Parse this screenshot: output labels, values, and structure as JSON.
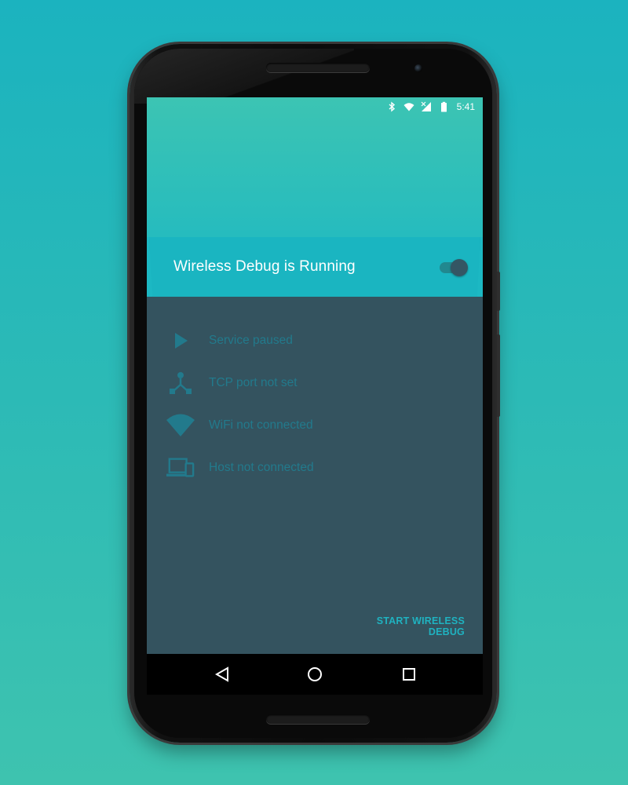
{
  "statusbar": {
    "time": "5:41",
    "icons": [
      "bluetooth-icon",
      "wifi-icon",
      "cell-signal-icon",
      "battery-icon"
    ]
  },
  "banner": {
    "title": "Wireless Debug is Running",
    "switch_on": true
  },
  "status_items": [
    {
      "icon": "play-icon",
      "label": "Service paused"
    },
    {
      "icon": "network-icon",
      "label": "TCP port not set"
    },
    {
      "icon": "wifi-icon",
      "label": "WiFi not connected"
    },
    {
      "icon": "devices-icon",
      "label": "Host not connected"
    }
  ],
  "action": {
    "label": "START WIRELESS DEBUG"
  },
  "navbar": {
    "buttons": [
      "back-icon",
      "home-icon",
      "recents-icon"
    ]
  },
  "colors": {
    "background": "#2cbab6",
    "header": "#3cc4b3",
    "banner": "#1ab5c1",
    "content": "#34535f",
    "muted_icon": "#227a8c",
    "accent": "#1fb2c0"
  }
}
